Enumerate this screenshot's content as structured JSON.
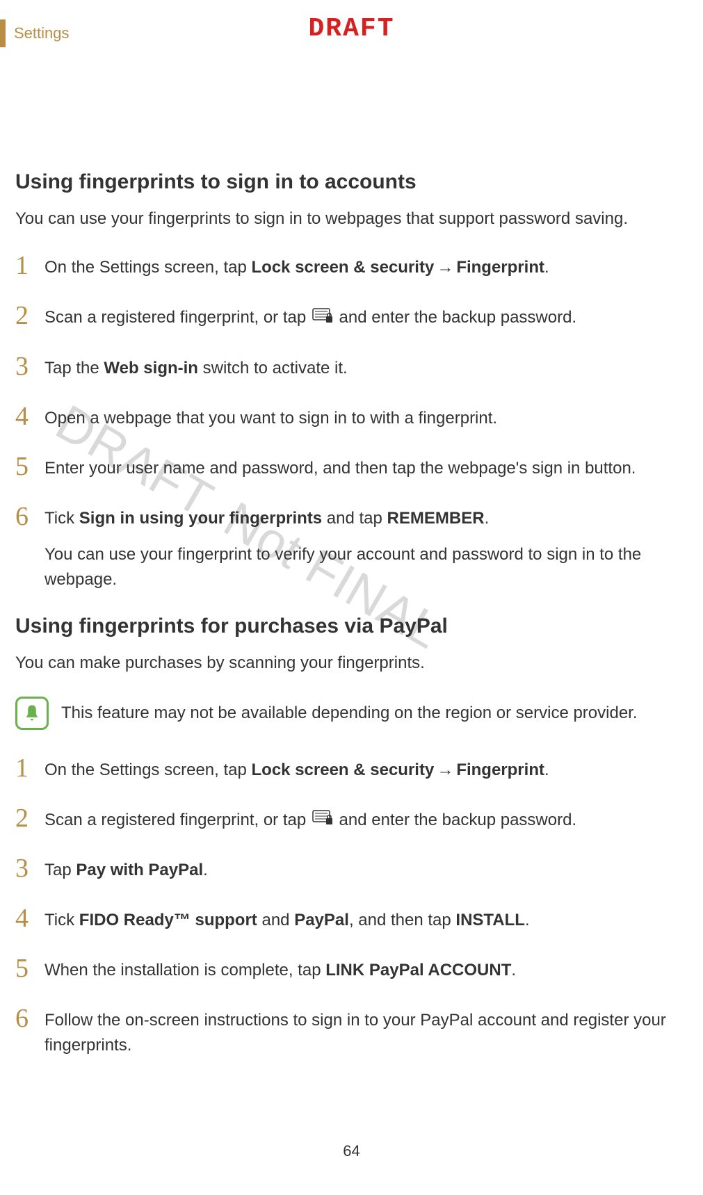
{
  "header": {
    "section_label": "Settings",
    "draft_label": "DRAFT"
  },
  "watermark": "DRAFT, Not FINAL",
  "section1": {
    "title": "Using fingerprints to sign in to accounts",
    "intro": "You can use your fingerprints to sign in to webpages that support password saving.",
    "steps": [
      {
        "n": "1",
        "pre": "On the Settings screen, tap ",
        "bold1": "Lock screen & security",
        "arrow": " → ",
        "bold2": "Fingerprint",
        "post": "."
      },
      {
        "n": "2",
        "pre": "Scan a registered fingerprint, or tap ",
        "post": " and enter the backup password."
      },
      {
        "n": "3",
        "pre": "Tap the ",
        "bold1": "Web sign-in",
        "post": " switch to activate it."
      },
      {
        "n": "4",
        "text": "Open a webpage that you want to sign in to with a fingerprint."
      },
      {
        "n": "5",
        "text": "Enter your user name and password, and then tap the webpage's sign in button."
      },
      {
        "n": "6",
        "pre": "Tick ",
        "bold1": "Sign in using your fingerprints",
        "mid": " and tap ",
        "bold2": "REMEMBER",
        "post": ".",
        "sub": "You can use your fingerprint to verify your account and password to sign in to the webpage."
      }
    ]
  },
  "section2": {
    "title": "Using fingerprints for purchases via PayPal",
    "intro": "You can make purchases by scanning your fingerprints.",
    "note": "This feature may not be available depending on the region or service provider.",
    "steps": [
      {
        "n": "1",
        "pre": "On the Settings screen, tap ",
        "bold1": "Lock screen & security",
        "arrow": " → ",
        "bold2": "Fingerprint",
        "post": "."
      },
      {
        "n": "2",
        "pre": "Scan a registered fingerprint, or tap ",
        "post": " and enter the backup password."
      },
      {
        "n": "3",
        "pre": "Tap ",
        "bold1": "Pay with PayPal",
        "post": "."
      },
      {
        "n": "4",
        "pre": "Tick ",
        "bold1": "FIDO Ready™ support",
        "mid": " and ",
        "bold2": "PayPal",
        "mid2": ", and then tap ",
        "bold3": "INSTALL",
        "post": "."
      },
      {
        "n": "5",
        "pre": "When the installation is complete, tap ",
        "bold1": "LINK PayPal ACCOUNT",
        "post": "."
      },
      {
        "n": "6",
        "text": "Follow the on-screen instructions to sign in to your PayPal account and register your fingerprints."
      }
    ]
  },
  "page_number": "64"
}
